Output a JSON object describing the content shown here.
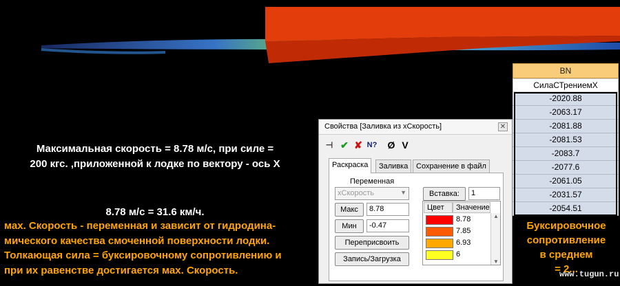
{
  "left_text": {
    "line1": "Максимальная скорость = 8.78 м/с, при силе =",
    "line2": "200 кгс. ,приложенной к лодке по вектору -  ось Х",
    "conversion": "8.78 м/с = 31.6 км/ч.",
    "para1": "мах. Скорость - переменная и зависит от гидродина-",
    "para2": "мического качества смоченной поверхности лодки.",
    "para3": "Толкающая сила = буксировочному сопротивлению и",
    "para4": "при их равенстве достигается мах. Скорость."
  },
  "dialog": {
    "title": "Свойства [Заливка из хСкорость]",
    "close_label": "✕",
    "toolbar": {
      "pin": "⊣",
      "ok": "✔",
      "cancel": "✘",
      "help": "N?",
      "null": "Ø",
      "v": "V"
    },
    "tabs": [
      "Раскраска",
      "Заливка",
      "Сохранение в файл"
    ],
    "variable_label": "Переменная",
    "variable_value": "хСкорость",
    "insert_label": "Вставка:",
    "insert_value": "1",
    "max_label": "Макс",
    "max_value": "8.78",
    "min_label": "Мин",
    "min_value": "-0.47",
    "reassign_label": "Переприсвоить",
    "saveload_label": "Запись/Загрузка",
    "color_table": {
      "headers": [
        "Цвет",
        "Значение"
      ],
      "rows": [
        {
          "color": "#ff0000",
          "value": "8.78"
        },
        {
          "color": "#ff5a00",
          "value": "7.85"
        },
        {
          "color": "#ffa800",
          "value": "6.93"
        },
        {
          "color": "#ffff20",
          "value": "6"
        }
      ]
    }
  },
  "sheet": {
    "column": "BN",
    "title": "СилаСТрениемX",
    "values": [
      "-2020.88",
      "-2063.17",
      "-2081.88",
      "-2081.53",
      "-2083.7",
      "-2077.6",
      "-2061.05",
      "-2031.57",
      "-2054.51"
    ]
  },
  "note": {
    "line1": "Буксировочное",
    "line2": "сопротивление",
    "line3": "в среднем",
    "line4": "= 2..."
  },
  "watermark": "www.tugun.ru",
  "colors": {
    "hull_red": "#e23d0b",
    "hull_red_dark": "#c02a05",
    "accent_orange": "#ffa500",
    "sheet_header": "#f8cc78",
    "sheet_cell": "#d4dbe9"
  }
}
